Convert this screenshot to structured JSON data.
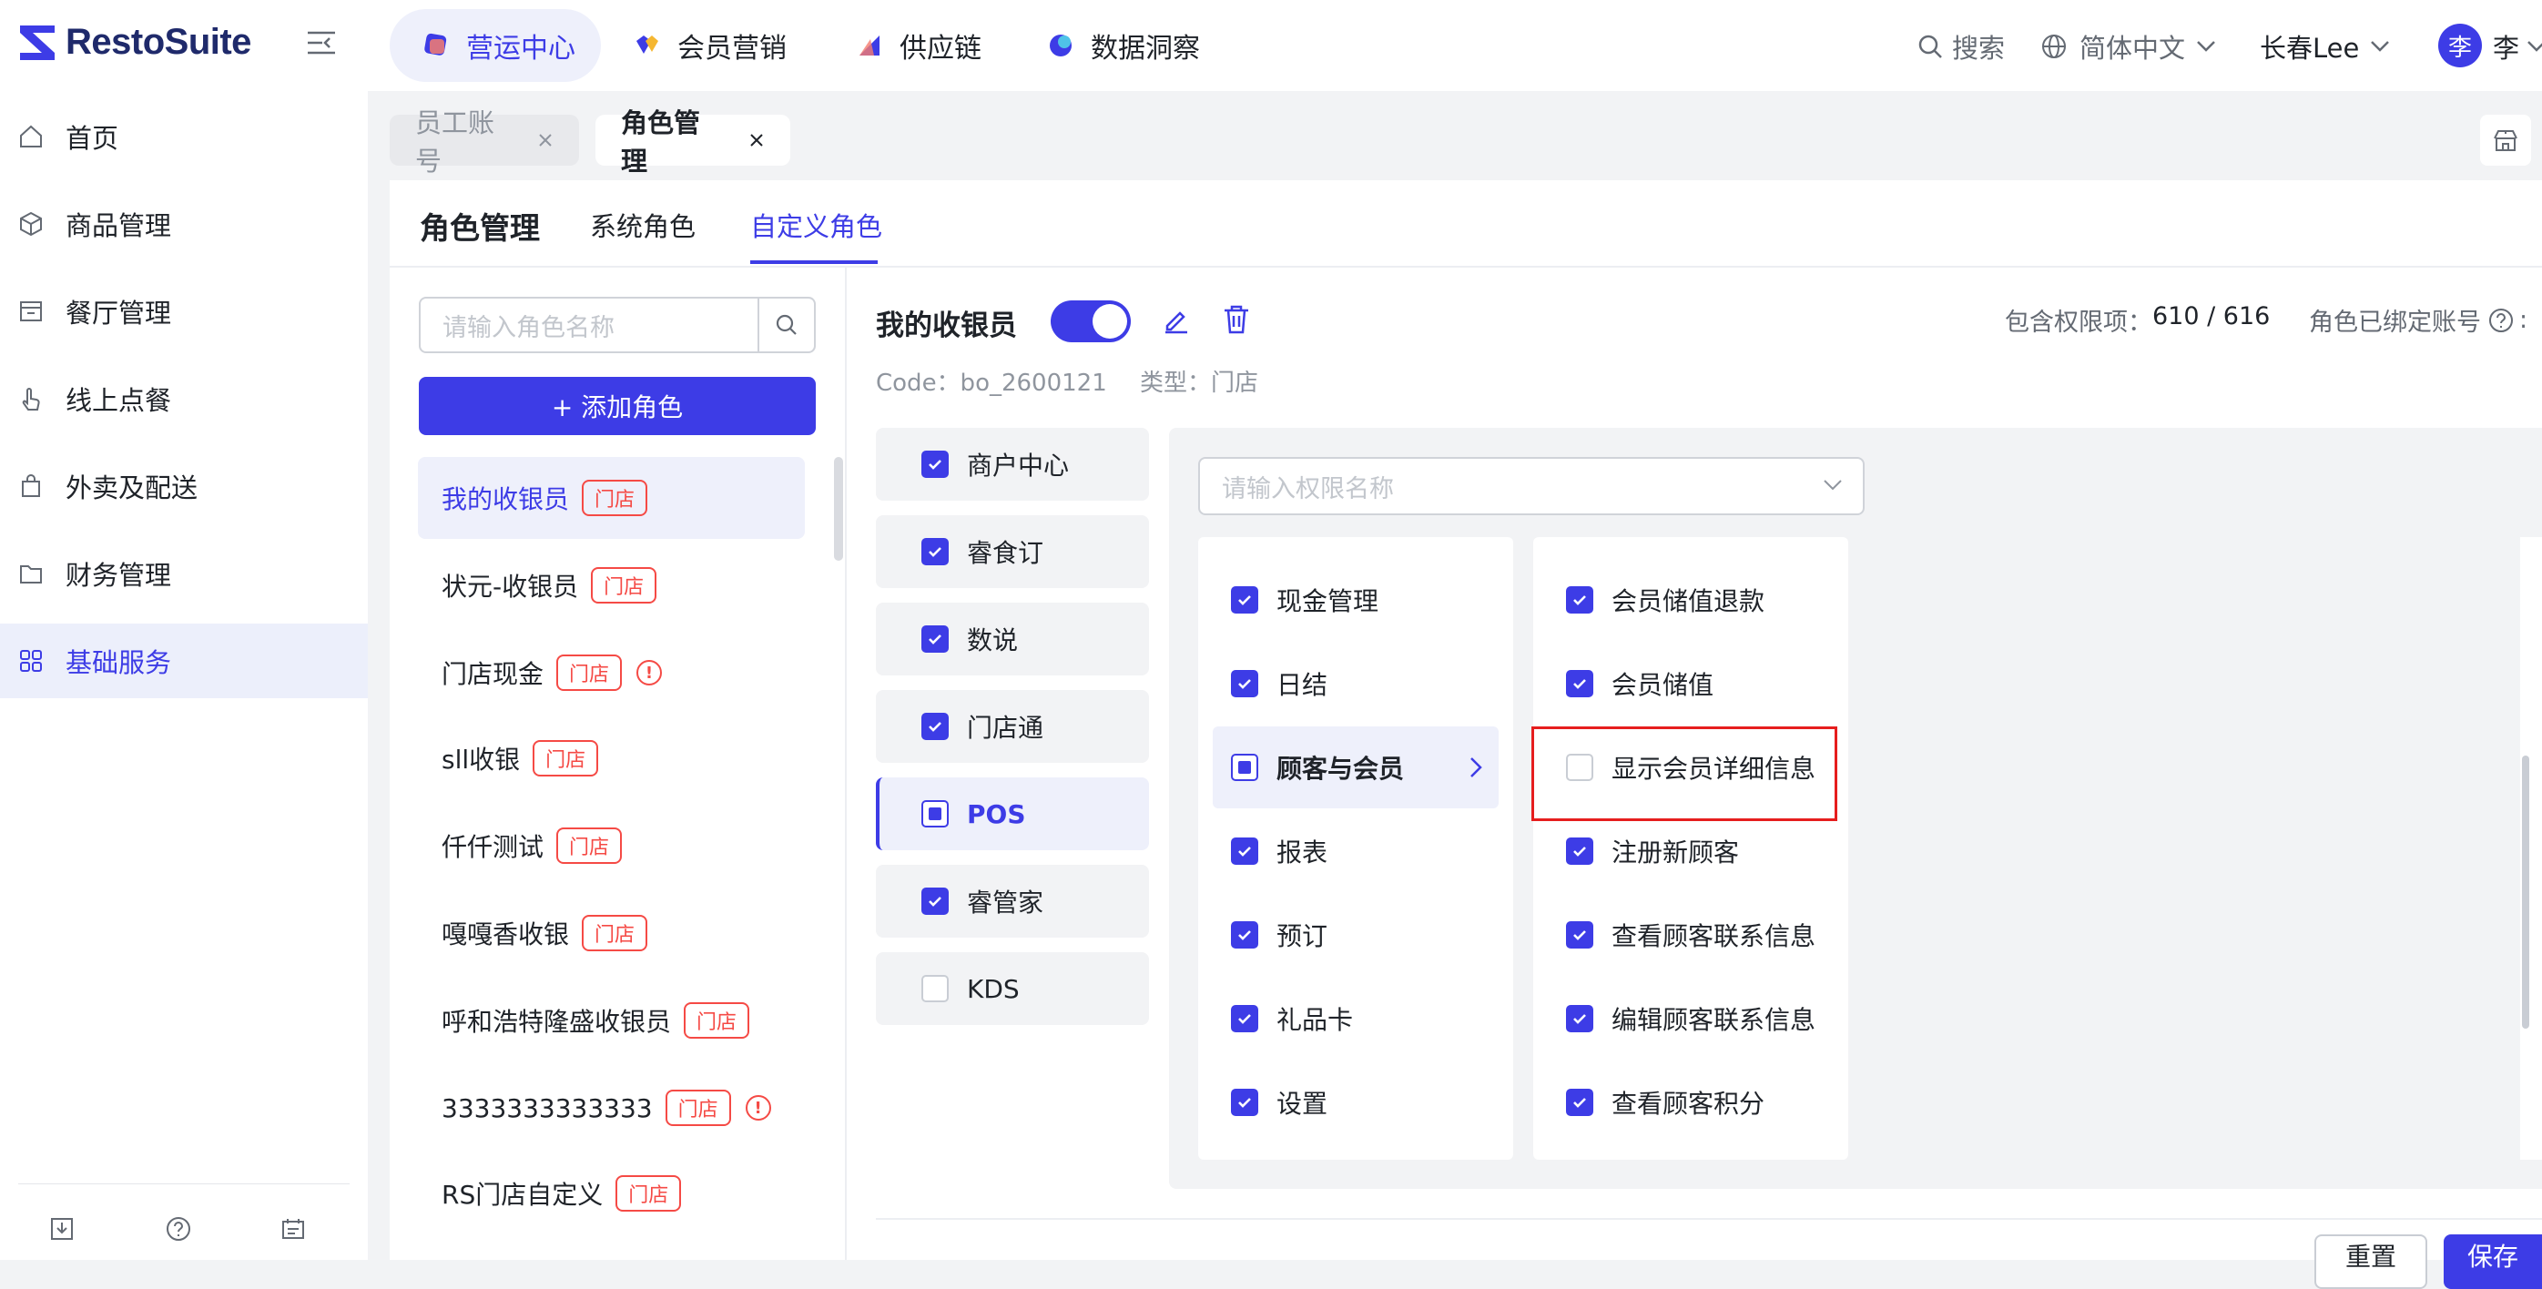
{
  "brand": {
    "name": "RestoSuite"
  },
  "topnav": {
    "items": [
      {
        "label": "营运中心",
        "icon": "operations-icon",
        "active": true
      },
      {
        "label": "会员营销",
        "icon": "member-marketing-icon",
        "active": false
      },
      {
        "label": "供应链",
        "icon": "supply-chain-icon",
        "active": false
      },
      {
        "label": "数据洞察",
        "icon": "data-insight-icon",
        "active": false
      }
    ],
    "search_label": "搜索",
    "language": "简体中文",
    "store": "长春Lee",
    "avatar_char": "李",
    "user_name": "李"
  },
  "sidebar": {
    "items": [
      {
        "label": "首页",
        "icon": "home-icon"
      },
      {
        "label": "商品管理",
        "icon": "cube-icon"
      },
      {
        "label": "餐厅管理",
        "icon": "store-icon"
      },
      {
        "label": "线上点餐",
        "icon": "tap-icon"
      },
      {
        "label": "外卖及配送",
        "icon": "bag-icon"
      },
      {
        "label": "财务管理",
        "icon": "folder-icon"
      },
      {
        "label": "基础服务",
        "icon": "grid-icon",
        "active": true
      }
    ]
  },
  "tabs": [
    {
      "label": "员工账号",
      "active": false
    },
    {
      "label": "角色管理",
      "active": true
    }
  ],
  "page": {
    "title": "角色管理",
    "subtabs": [
      "系统角色",
      "自定义角色"
    ],
    "active_subtab": "自定义角色"
  },
  "role_list": {
    "search_placeholder": "请输入角色名称",
    "add_button": "+ 添加角色",
    "items": [
      {
        "name": "我的收银员",
        "tag": "门店",
        "selected": true,
        "warning": false
      },
      {
        "name": "状元-收银员",
        "tag": "门店",
        "warning": false
      },
      {
        "name": "门店现金",
        "tag": "门店",
        "warning": true
      },
      {
        "name": "sll收银",
        "tag": "门店",
        "warning": false
      },
      {
        "name": "仟仟测试",
        "tag": "门店",
        "warning": false
      },
      {
        "name": "嘎嘎香收银",
        "tag": "门店",
        "warning": false
      },
      {
        "name": "呼和浩特隆盛收银员",
        "tag": "门店",
        "warning": false
      },
      {
        "name": "3333333333333",
        "tag": "门店",
        "warning": true
      },
      {
        "name": "RS门店自定义",
        "tag": "门店",
        "warning": false
      }
    ]
  },
  "role_detail": {
    "name": "我的收银员",
    "enabled": true,
    "code": "Code：bo_2600121",
    "type": "类型：门店",
    "permission_count_label": "包含权限项：",
    "permission_count": "610 / 616",
    "bound_accounts_label": "角色已绑定账号",
    "permission_search_placeholder": "请输入权限名称"
  },
  "modules": [
    {
      "label": "商户中心",
      "state": "checked"
    },
    {
      "label": "睿食订",
      "state": "checked"
    },
    {
      "label": "数说",
      "state": "checked"
    },
    {
      "label": "门店通",
      "state": "checked"
    },
    {
      "label": "POS",
      "state": "indeterminate",
      "selected": true
    },
    {
      "label": "睿管家",
      "state": "checked"
    },
    {
      "label": "KDS",
      "state": "unchecked"
    }
  ],
  "pos_categories": [
    {
      "label": "现金管理",
      "state": "checked"
    },
    {
      "label": "日结",
      "state": "checked"
    },
    {
      "label": "顾客与会员",
      "state": "indeterminate",
      "selected": true
    },
    {
      "label": "报表",
      "state": "checked"
    },
    {
      "label": "预订",
      "state": "checked"
    },
    {
      "label": "礼品卡",
      "state": "checked"
    },
    {
      "label": "设置",
      "state": "checked"
    }
  ],
  "member_permissions": [
    {
      "label": "会员储值退款",
      "state": "checked"
    },
    {
      "label": "会员储值",
      "state": "checked"
    },
    {
      "label": "显示会员详细信息",
      "state": "unchecked",
      "highlighted": true
    },
    {
      "label": "注册新顾客",
      "state": "checked"
    },
    {
      "label": "查看顾客联系信息",
      "state": "checked"
    },
    {
      "label": "编辑顾客联系信息",
      "state": "checked"
    },
    {
      "label": "查看顾客积分",
      "state": "checked"
    }
  ],
  "footer": {
    "reset_label": "重置",
    "save_label": "保存"
  },
  "colors": {
    "primary": "#3d3ce6",
    "danger": "#f54a45",
    "bg": "#f2f3f5"
  }
}
